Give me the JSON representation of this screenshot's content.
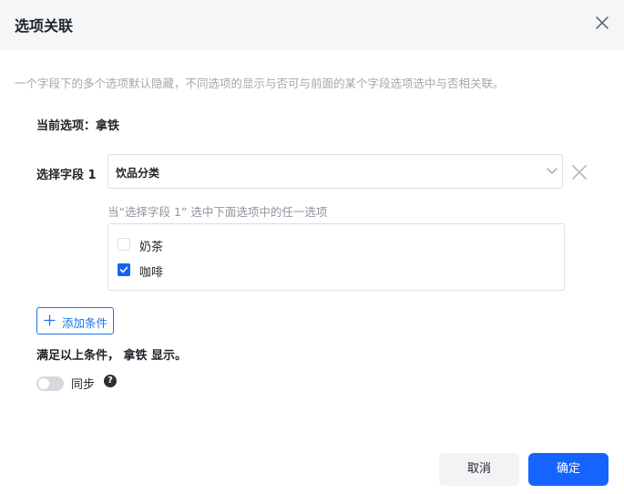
{
  "dialog": {
    "title": "选项关联",
    "close_icon": "close-icon"
  },
  "description": "一个字段下的多个选项默认隐藏，不同选项的显示与否可与前面的某个字段选项选中与否相关联。",
  "current_option": "当前选项：拿铁",
  "condition": {
    "field_label": "选择字段 1",
    "selected_field": "饮品分类",
    "hint": "当“选择字段 1” 选中下面选项中的任一选项",
    "options": [
      {
        "label": "奶茶",
        "checked": false
      },
      {
        "label": "咖啡",
        "checked": true
      }
    ]
  },
  "add_condition_label": "添加条件",
  "conditions_result": "满足以上条件， 拿铁 显示。",
  "sync": {
    "label": "同步",
    "enabled": false,
    "help": "?"
  },
  "footer": {
    "cancel_label": "取消",
    "confirm_label": "确定"
  },
  "colors": {
    "primary": "#1664ff",
    "header_bg": "#f5f6f7",
    "checkbox_checked": "#1364f5"
  }
}
